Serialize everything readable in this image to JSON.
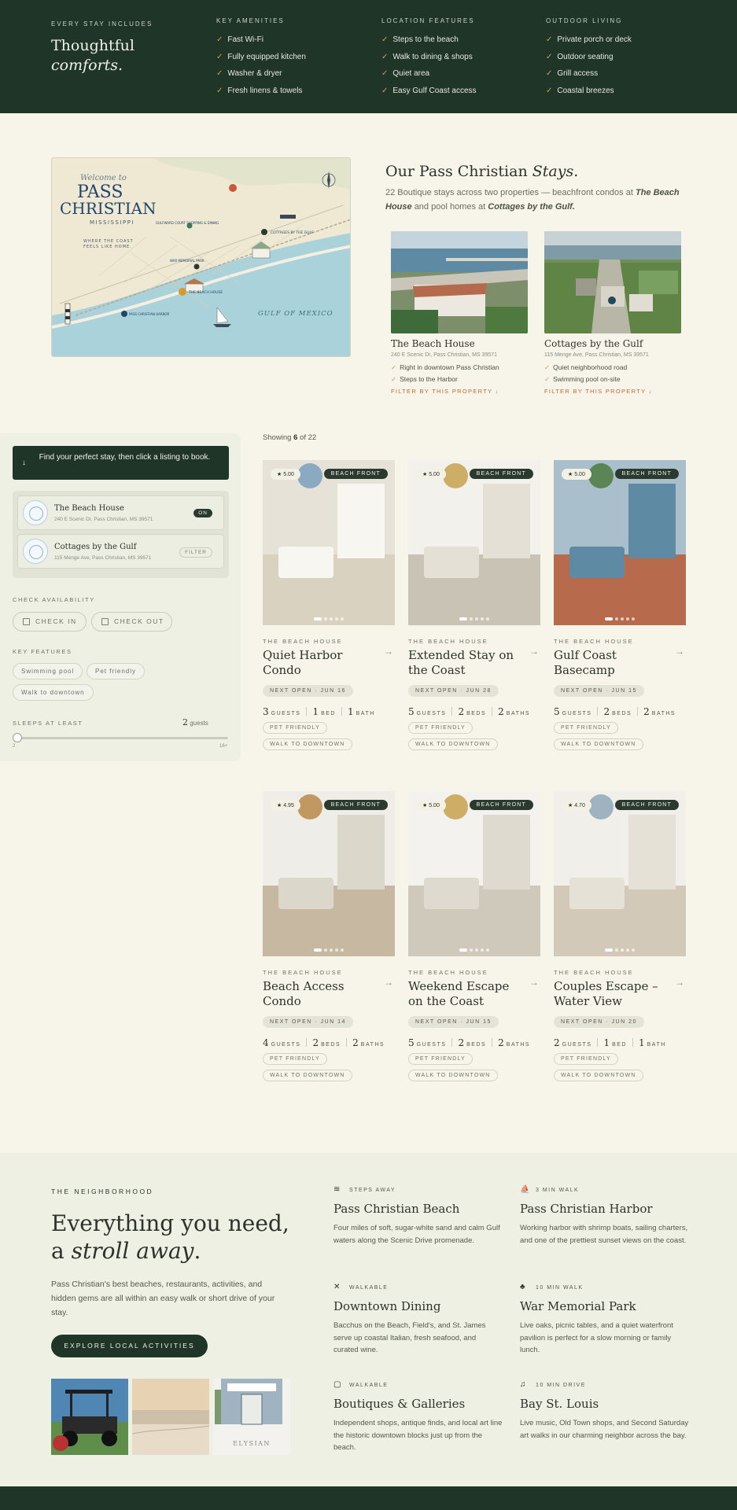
{
  "amenities": {
    "kicker": "EVERY STAY INCLUDES",
    "title_line1": "Thoughtful",
    "title_line2": "comforts.",
    "columns": [
      {
        "heading": "KEY AMENITIES",
        "items": [
          "Fast Wi-Fi",
          "Fully equipped kitchen",
          "Washer & dryer",
          "Fresh linens & towels"
        ]
      },
      {
        "heading": "LOCATION FEATURES",
        "items": [
          "Steps to the beach",
          "Walk to dining & shops",
          "Quiet area",
          "Easy Gulf Coast access"
        ]
      },
      {
        "heading": "OUTDOOR LIVING",
        "items": [
          "Private porch or deck",
          "Outdoor seating",
          "Grill access",
          "Coastal breezes"
        ]
      }
    ]
  },
  "map": {
    "welcome": "Welcome to",
    "city_line1": "PASS",
    "city_line2": "CHRISTIAN",
    "state": "MISSISSIPPI",
    "tagline_line1": "WHERE THE COAST",
    "tagline_line2": "FEELS LIKE HOME.",
    "gulf": "GULF OF MEXICO",
    "pin_beach_house": "THE BEACH HOUSE",
    "pin_cottages": "COTTAGES BY THE GULF",
    "pin_harbor": "PASS CHRISTIAN HARBOR",
    "pin_park": "WAR MEMORIAL PARK",
    "pin_school": "GULFWARD COURT SHOPPING & DINING"
  },
  "stays": {
    "title": "Our Pass Christian",
    "title_italic": "Stays.",
    "desc_prefix": "22 Boutique stays across two properties — beachfront condos at",
    "desc_prop1": "The Beach House",
    "desc_mid": "and pool homes at",
    "desc_prop2": "Cottages by the Gulf.",
    "properties": [
      {
        "name": "The Beach House",
        "address": "240 E Scenic Dr, Pass Christian, MS 39571",
        "features": [
          "Right in downtown Pass Christian",
          "Steps to the Harbor"
        ],
        "filter": "FILTER BY THIS PROPERTY ↓"
      },
      {
        "name": "Cottages by the Gulf",
        "address": "115 Menge Ave, Pass Christian, MS 39571",
        "features": [
          "Quiet neighborhood road",
          "Swimming pool on-site"
        ],
        "filter": "FILTER BY THIS PROPERTY ↓"
      }
    ]
  },
  "sidebar": {
    "find_text": "Find your perfect stay, then click a listing to book.",
    "props": [
      {
        "name": "The Beach House",
        "address": "240 E Scenic Dr, Pass Christian, MS 39571",
        "tag": "ON"
      },
      {
        "name": "Cottages by the Gulf",
        "address": "115 Menge Ave, Pass Christian, MS 39571",
        "tag": "FILTER"
      }
    ],
    "availability_label": "CHECK AVAILABILITY",
    "check_in": "CHECK IN",
    "check_out": "CHECK OUT",
    "features_label": "KEY FEATURES",
    "features": [
      "Swimming pool",
      "Pet friendly",
      "Walk to downtown"
    ],
    "sleeps_label": "SLEEPS AT LEAST",
    "sleeps_value": "2",
    "sleeps_unit": "guests",
    "range_min": "2",
    "range_max": "16+",
    "slider_fraction": 0.0
  },
  "listing": {
    "showing_prefix": "Showing",
    "showing_count": "6",
    "showing_suffix": "of 22",
    "cards": [
      {
        "rating": "★ 5.00",
        "badge": "BEACH FRONT",
        "property": "THE BEACH HOUSE",
        "title": "Quiet Harbor Condo",
        "next_open": "NEXT OPEN · JUN 16",
        "guests": "3",
        "guests_label": "GUESTS",
        "beds": "1",
        "beds_label": "BED",
        "baths": "1",
        "baths_label": "BATH",
        "tags": [
          "PET FRIENDLY",
          "WALK TO DOWNTOWN"
        ],
        "arrow": "→"
      },
      {
        "rating": "★ 5.00",
        "badge": "BEACH FRONT",
        "property": "THE BEACH HOUSE",
        "title": "Extended Stay on the Coast",
        "next_open": "NEXT OPEN · JUN 28",
        "guests": "5",
        "guests_label": "GUESTS",
        "beds": "2",
        "beds_label": "BEDS",
        "baths": "2",
        "baths_label": "BATHS",
        "tags": [
          "PET FRIENDLY",
          "WALK TO DOWNTOWN"
        ],
        "arrow": "→"
      },
      {
        "rating": "★ 5.00",
        "badge": "BEACH FRONT",
        "property": "THE BEACH HOUSE",
        "title": "Gulf Coast Basecamp",
        "next_open": "NEXT OPEN · JUN 15",
        "guests": "5",
        "guests_label": "GUESTS",
        "beds": "2",
        "beds_label": "BEDS",
        "baths": "2",
        "baths_label": "BATHS",
        "tags": [
          "PET FRIENDLY",
          "WALK TO DOWNTOWN"
        ],
        "arrow": "→"
      },
      {
        "rating": "★ 4.95",
        "badge": "BEACH FRONT",
        "property": "THE BEACH HOUSE",
        "title": "Beach Access Condo",
        "next_open": "NEXT OPEN · JUN 14",
        "guests": "4",
        "guests_label": "GUESTS",
        "beds": "2",
        "beds_label": "BEDS",
        "baths": "2",
        "baths_label": "BATHS",
        "tags": [
          "PET FRIENDLY",
          "WALK TO DOWNTOWN"
        ],
        "arrow": "→"
      },
      {
        "rating": "★ 5.00",
        "badge": "BEACH FRONT",
        "property": "THE BEACH HOUSE",
        "title": "Weekend Escape on the Coast",
        "next_open": "NEXT OPEN · JUN 15",
        "guests": "5",
        "guests_label": "GUESTS",
        "beds": "2",
        "beds_label": "BEDS",
        "baths": "2",
        "baths_label": "BATHS",
        "tags": [
          "PET FRIENDLY",
          "WALK TO DOWNTOWN"
        ],
        "arrow": "→"
      },
      {
        "rating": "★ 4.70",
        "badge": "BEACH FRONT",
        "property": "THE BEACH HOUSE",
        "title": "Couples Escape – Water View",
        "next_open": "NEXT OPEN · JUN 20",
        "guests": "2",
        "guests_label": "GUESTS",
        "beds": "1",
        "beds_label": "BED",
        "baths": "1",
        "baths_label": "BATH",
        "tags": [
          "PET FRIENDLY",
          "WALK TO DOWNTOWN"
        ],
        "arrow": "→"
      }
    ]
  },
  "neighborhood": {
    "kicker": "THE NEIGHBORHOOD",
    "headline_line1": "Everything you need,",
    "headline_a": "a",
    "headline_italic": "stroll away",
    "headline_end": ".",
    "lead": "Pass Christian's best beaches, restaurants, activities, and hidden gems are all within an easy walk or short drive of your stay.",
    "button": "EXPLORE LOCAL ACTIVITIES",
    "image_caption": "ELYSIAN",
    "spots": [
      {
        "icon": "≋",
        "icon_name": "waves-icon",
        "distance": "STEPS AWAY",
        "name": "Pass Christian Beach",
        "desc": "Four miles of soft, sugar-white sand and calm Gulf waters along the Scenic Drive promenade."
      },
      {
        "icon": "⛵",
        "icon_name": "sailboat-icon",
        "distance": "3 MIN WALK",
        "name": "Pass Christian Harbor",
        "desc": "Working harbor with shrimp boats, sailing charters, and one of the prettiest sunset views on the coast."
      },
      {
        "icon": "✕",
        "icon_name": "utensils-icon",
        "distance": "WALKABLE",
        "name": "Downtown Dining",
        "desc": "Bacchus on the Beach, Field's, and St. James serve up coastal Italian, fresh seafood, and curated wine."
      },
      {
        "icon": "♣",
        "icon_name": "tree-icon",
        "distance": "10 MIN WALK",
        "name": "War Memorial Park",
        "desc": "Live oaks, picnic tables, and a quiet waterfront pavilion is perfect for a slow morning or family lunch."
      },
      {
        "icon": "▢",
        "icon_name": "shopping-bag-icon",
        "distance": "WALKABLE",
        "name": "Boutiques & Galleries",
        "desc": "Independent shops, antique finds, and local art line the historic downtown blocks just up from the beach."
      },
      {
        "icon": "♫",
        "icon_name": "music-icon",
        "distance": "10 MIN DRIVE",
        "name": "Bay St. Louis",
        "desc": "Live music, Old Town shops, and Second Saturday art walks in our charming neighbor across the bay."
      }
    ]
  },
  "colors": {
    "forest": "#1f3528",
    "cream": "#f7f5ea",
    "sage": "#eef0e3",
    "gold": "#c9a24a",
    "rust": "#c06a34"
  }
}
